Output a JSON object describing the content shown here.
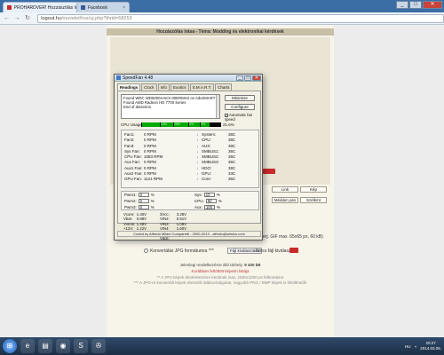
{
  "browser": {
    "tabs": [
      {
        "label": "PROHARDVER! - Hozzászólás írása - Téma: Modding és elektronikai kérdések",
        "short": "PROHARDVER! Hozzászólás írása -",
        "active": true
      },
      {
        "label": "Facebook",
        "active": false
      }
    ],
    "url_host": "logout.hu",
    "url_path": "/muvelet/hsz/uj.php?thrid=58253",
    "window_controls": [
      "_",
      "□",
      "✕"
    ]
  },
  "page": {
    "header": "Hozzászólás írása - Téma: Modding és elektronikai kérdések",
    "buttons_row1": [
      "Link",
      "Kép"
    ],
    "buttons_row2": [
      "Médiám pés",
      "Szélkmt"
    ],
    "file_row_text": "erj. GIF max. 65x65 px, 60 kB)",
    "radio_label": "Konvertálás JPG formátumra ***",
    "file_button": "Fájl kiválasztása",
    "file_status": "Nincs fájl kiválasztva",
    "limit_text": "Jelenlegi rendelkezésre álló tárhely:",
    "limit_value": "9 400 kB",
    "note_red": "Korábban feltöltött képeim listája",
    "note_grey1": "** A JPG képek átméretezésre kerülnek max. 1920x1200 px felbontásra",
    "note_grey2": "*** A JPG-re konvertált képek elvesztik átlátszóságukat, nagyobb PNG / BMP képek is feltölthetők"
  },
  "speedfan": {
    "title": "SpeedFan 4.48",
    "tabs": [
      "Readings",
      "Clock",
      "Info",
      "Exotics",
      "S.M.A.R.T.",
      "Charts"
    ],
    "log": [
      "Found WDC WD5000AAKX-00ERMA0 on AdvSMART",
      "Found AMD Radeon HD 7700 Series",
      "End of detection"
    ],
    "minimize_label": "Minimize",
    "configure_label": "Configure",
    "autoscale_label": "Automatic fan speed",
    "cpu_usage_label": "CPU Usage",
    "cpu_usage_value": "21.6%",
    "cpu_bars": [
      "",
      "13%",
      "28%",
      "6%",
      "4%"
    ],
    "fans": [
      {
        "name": "Fan1:",
        "value": "0 RPM"
      },
      {
        "name": "Fan2:",
        "value": "0 RPM"
      },
      {
        "name": "Fan3:",
        "value": "0 RPM"
      },
      {
        "name": "Sys Fan:",
        "value": "0 RPM"
      },
      {
        "name": "CPU Fan:",
        "value": "1083 RPM"
      },
      {
        "name": "Aux Fan:",
        "value": "0 RPM"
      },
      {
        "name": "Aux1 Fan:",
        "value": "0 RPM"
      },
      {
        "name": "Aux2 Fan:",
        "value": "0 RPM"
      },
      {
        "name": "GPU Fan:",
        "value": "1121 RPM"
      }
    ],
    "temps": [
      {
        "name": "System:",
        "value": "38C"
      },
      {
        "name": "CPU:",
        "value": "38C"
      },
      {
        "name": "AUX:",
        "value": "38C"
      },
      {
        "name": "SMBUS1:",
        "value": "36C"
      },
      {
        "name": "SMBUS2:",
        "value": "36C"
      },
      {
        "name": "SMBUS3:",
        "value": "36C"
      },
      {
        "name": "HDO:",
        "value": "38C"
      },
      {
        "name": "GPU:",
        "value": "33C"
      },
      {
        "name": "Core:",
        "value": "36C"
      }
    ],
    "pwm": [
      {
        "label": "Pwm1:",
        "value": "0",
        "unit": "%"
      },
      {
        "label": "Pwm2:",
        "value": "0",
        "unit": "%"
      },
      {
        "label": "Pwm3:",
        "value": "0",
        "unit": "%"
      }
    ],
    "pwm_right": [
      {
        "label": "Sys:",
        "value": "10",
        "unit": "%"
      },
      {
        "label": "CPU:",
        "value": "90",
        "unit": "%"
      },
      {
        "label": "Aux:",
        "value": "100",
        "unit": "%"
      }
    ],
    "volts_col1": [
      {
        "k": "Vcore:",
        "v": "1.40V"
      },
      {
        "k": "Vbat:",
        "v": "0.88V"
      },
      {
        "k": "Vvmm:",
        "v": "1.38V"
      },
      {
        "k": "+12V:",
        "v": "1.22V"
      },
      {
        "k": "AVcc:",
        "v": "3.28V"
      }
    ],
    "volts_col2": [
      {
        "k": "3Vcc:",
        "v": "3.28V"
      },
      {
        "k": "VIN2:",
        "v": "0.51V"
      },
      {
        "k": "VIN3:",
        "v": "1.08V"
      },
      {
        "k": "VIN4:",
        "v": "1.60V"
      },
      {
        "k": "GPU Vddc:",
        "v": "0.82V"
      }
    ],
    "footer": "Coded by Alfredo Milani Comparetti - 2000-2013 - alfredo@almico.com"
  },
  "taskbar": {
    "apps": [
      "IE",
      "Files",
      "Chrome",
      "Skype",
      "SpeedFan"
    ],
    "lang": "HU",
    "time": "20:27",
    "date": "2014.03.05."
  },
  "colors": {
    "accent_red": "#c82a2a",
    "taskbar": "#1c2f46",
    "tabbar": "#3a6ea5"
  }
}
